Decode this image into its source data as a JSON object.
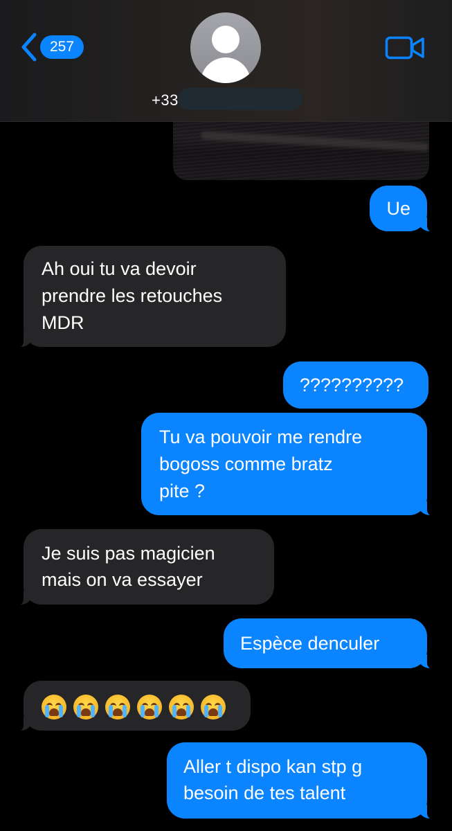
{
  "header": {
    "back_count": "257",
    "phone_prefix": "+33"
  },
  "messages": [
    {
      "direction": "out",
      "text": "Ue"
    },
    {
      "direction": "in",
      "lines": [
        "Ah oui tu va devoir",
        "prendre les retouches",
        "MDR"
      ]
    },
    {
      "direction": "out",
      "text": "??????????"
    },
    {
      "direction": "out",
      "lines": [
        "Tu va pouvoir me rendre",
        "bogoss comme bratz",
        "pite ?"
      ]
    },
    {
      "direction": "in",
      "lines": [
        "Je suis pas magicien",
        "mais on va essayer"
      ]
    },
    {
      "direction": "out",
      "text": "Espèce denculer"
    },
    {
      "direction": "in",
      "emoji": "loudly-crying-face",
      "emoji_count": 6
    },
    {
      "direction": "out",
      "lines": [
        "Aller t dispo kan stp g",
        "besoin de tes talent"
      ]
    }
  ],
  "colors": {
    "outgoing_bubble": "#0a84ff",
    "incoming_bubble": "#262628",
    "background": "#000000"
  }
}
